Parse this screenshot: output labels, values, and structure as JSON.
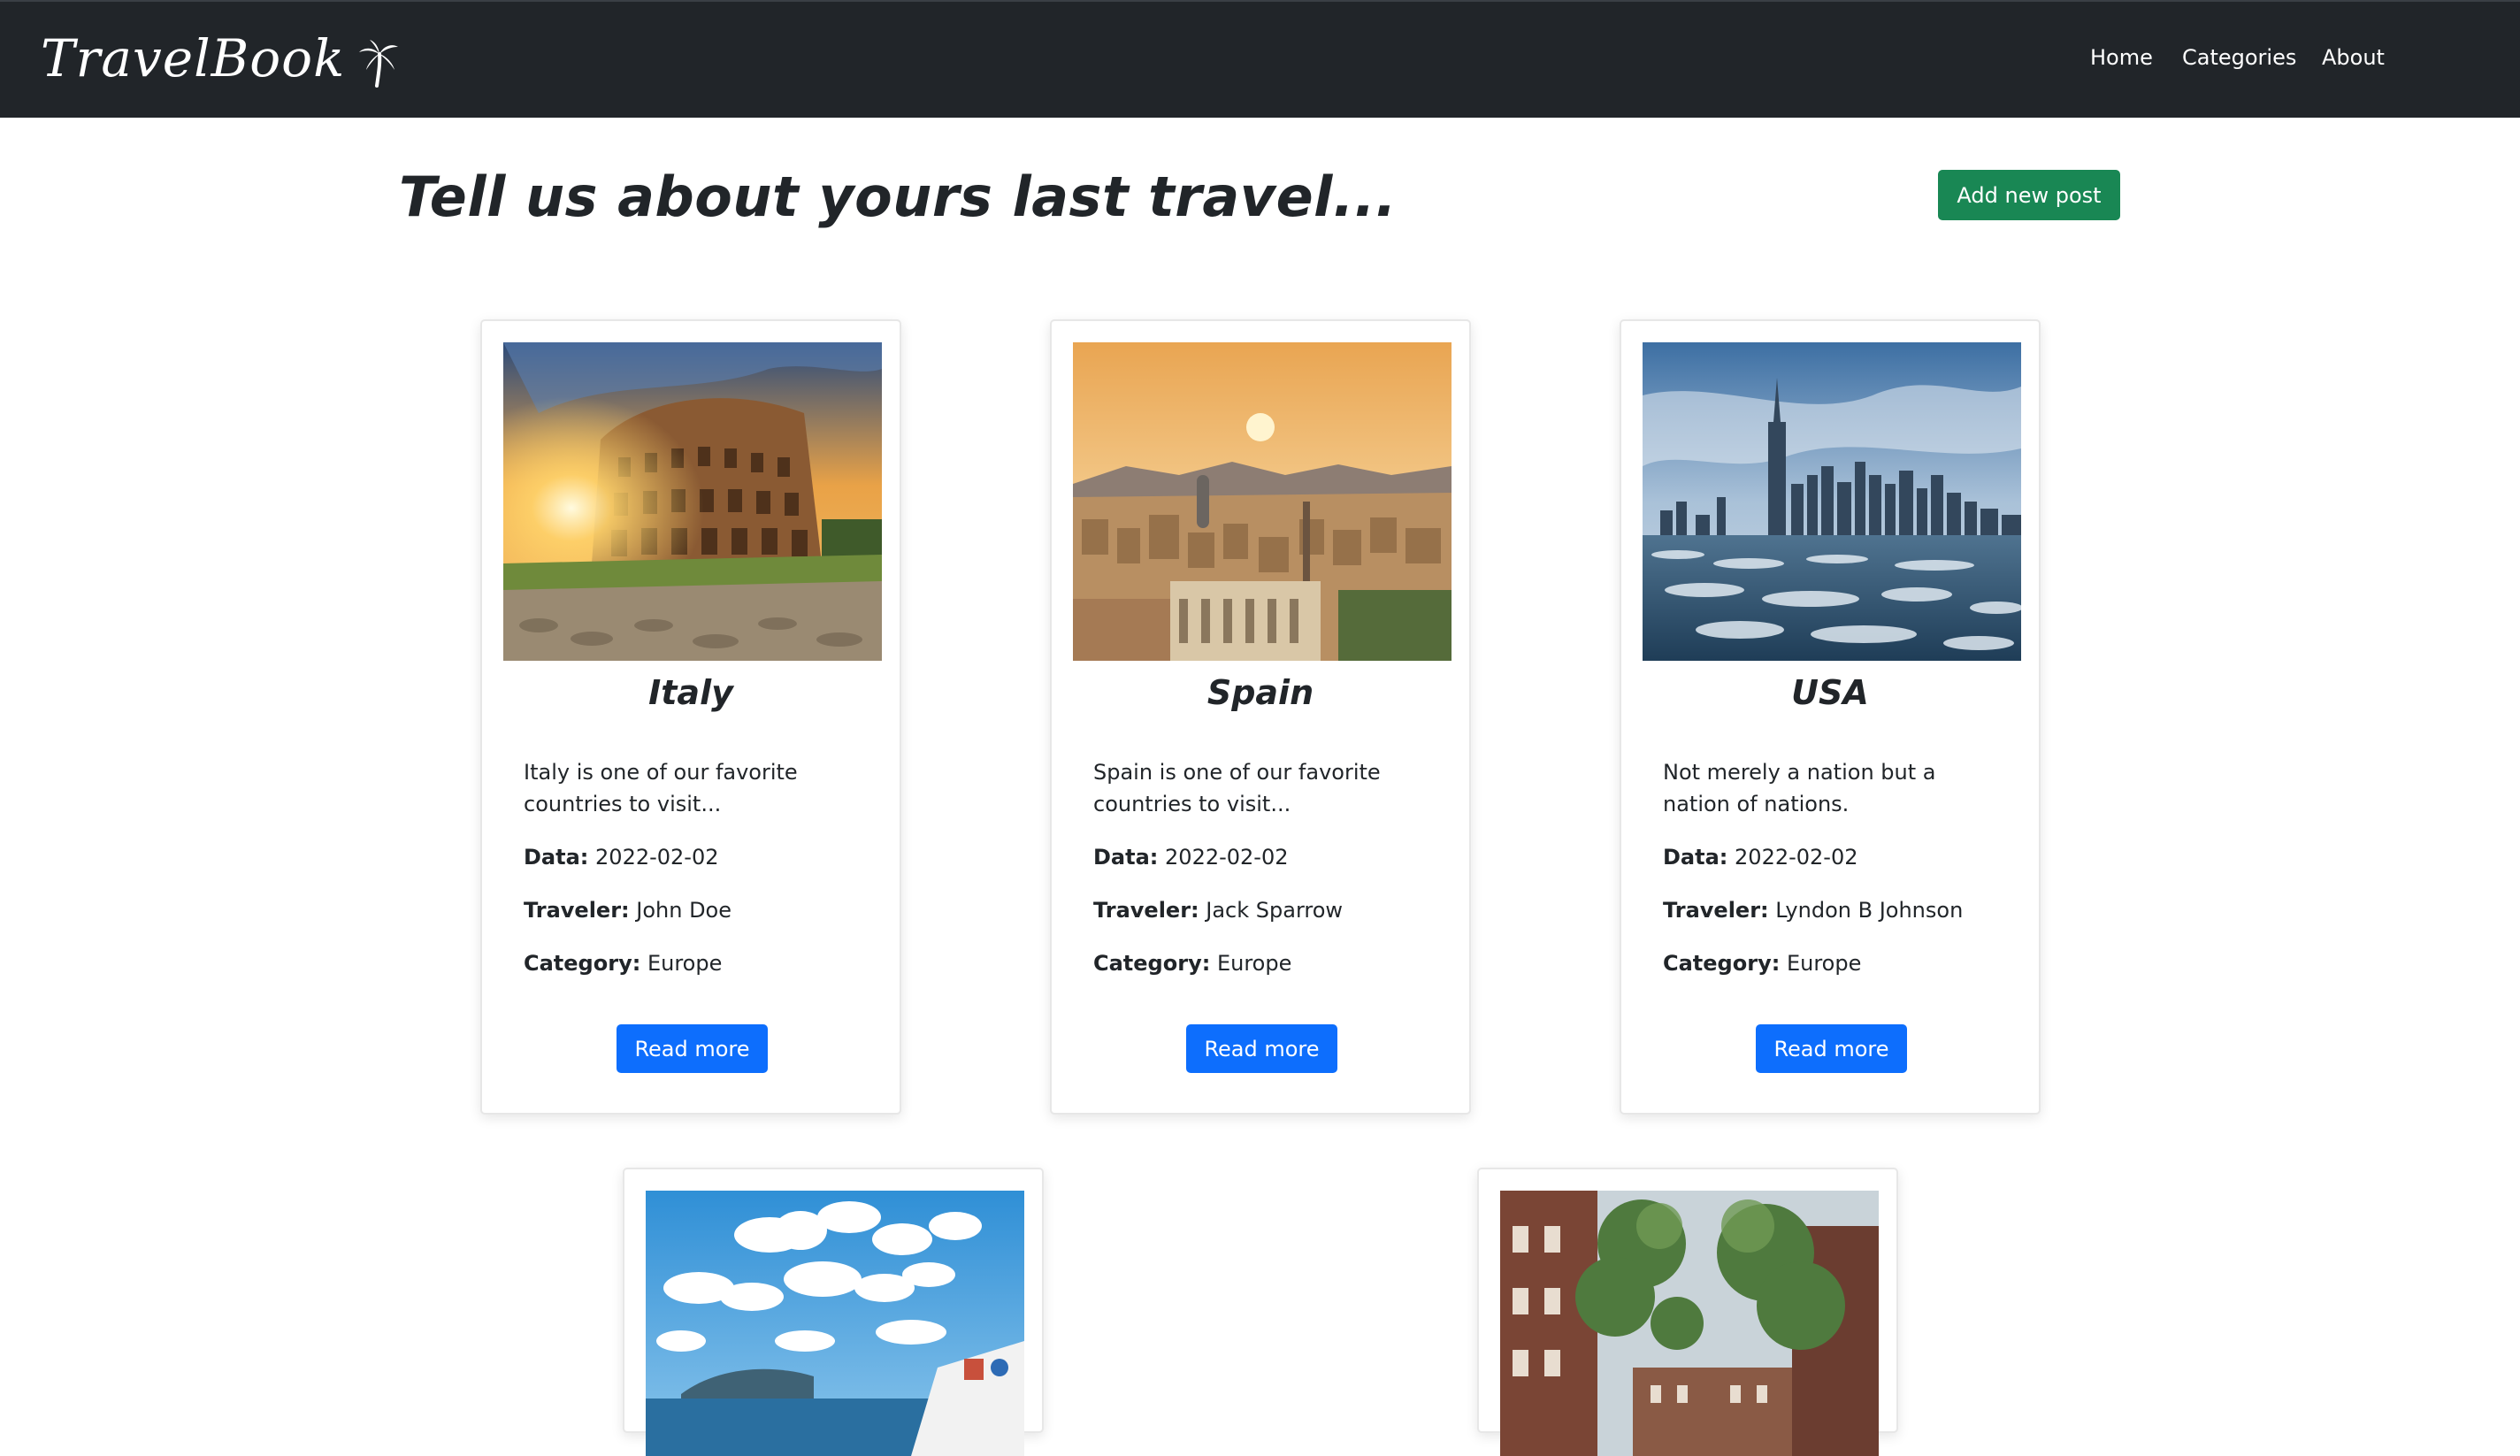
{
  "app": {
    "brand": "TravelBook",
    "brand_icon": "palm-tree-icon"
  },
  "nav": {
    "items": [
      {
        "label": "Home"
      },
      {
        "label": "Categories"
      },
      {
        "label": "About"
      }
    ]
  },
  "main": {
    "heading": "Tell us about yours last travel...",
    "add_button": "Add new post"
  },
  "posts": [
    {
      "title": "Italy",
      "description": "Italy is one of our favorite countries to visit...",
      "date_label": "Data:",
      "date": "2022-02-02",
      "traveler_label": "Traveler:",
      "traveler": "John Doe",
      "category_label": "Category:",
      "category": "Europe",
      "button": "Read more",
      "image": "colosseum-photo"
    },
    {
      "title": "Spain",
      "description": "Spain is one of our favorite countries to visit...",
      "date_label": "Data:",
      "date": "2022-02-02",
      "traveler_label": "Traveler:",
      "traveler": "Jack Sparrow",
      "category_label": "Category:",
      "category": "Europe",
      "button": "Read more",
      "image": "barcelona-skyline-photo"
    },
    {
      "title": "USA",
      "description": "Not merely a nation but a nation of nations.",
      "date_label": "Data:",
      "date": "2022-02-02",
      "traveler_label": "Traveler:",
      "traveler": "Lyndon B Johnson",
      "category_label": "Category:",
      "category": "Europe",
      "button": "Read more",
      "image": "new-york-skyline-photo"
    },
    {
      "image": "santorini-photo"
    },
    {
      "image": "amsterdam-street-photo"
    }
  ],
  "colors": {
    "navbar": "#212529",
    "add_button": "#198754",
    "read_button": "#0d6efd"
  }
}
